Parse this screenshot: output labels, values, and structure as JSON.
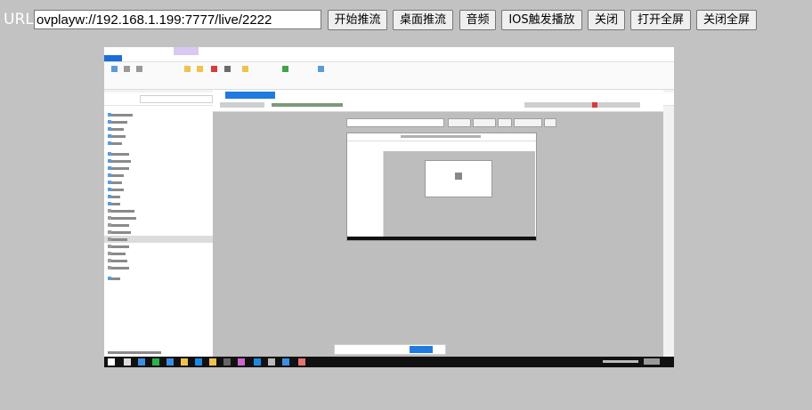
{
  "toolbar": {
    "url_label": "URL:",
    "url_value": "ovplayw://192.168.1.199:7777/live/2222",
    "buttons": {
      "start_push": "开始推流",
      "desktop_push": "桌面推流",
      "audio": "音频",
      "ios_play": "IOS触发播放",
      "close": "关闭",
      "open_fullscreen": "打开全屏",
      "close_fullscreen": "关闭全屏"
    }
  },
  "colors": {
    "page_background": "#c2c2c2",
    "url_label": "#ffffff",
    "button_face": "#efefef",
    "accent_blue": "#1f7be0",
    "taskbar": "#111111"
  },
  "stream_view": {
    "content": "live remote desktop video frame (recursive capture of this page inside a browser over a file explorer)"
  }
}
